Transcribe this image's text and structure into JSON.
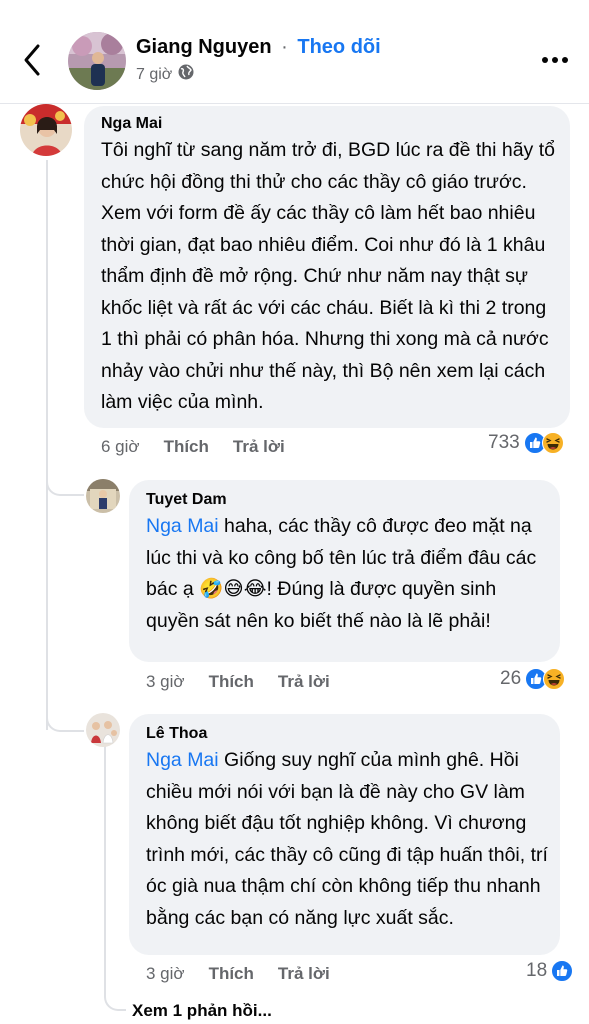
{
  "header": {
    "author": "Giang Nguyen",
    "separator": "·",
    "follow_label": "Theo dõi",
    "time": "7 giờ",
    "audience_icon": "globe-icon",
    "back_icon": "back-arrow-icon",
    "more_icon": "more-icon"
  },
  "comments": [
    {
      "author": "Nga Mai",
      "text": "Tôi nghĩ từ  sang năm trở đi, BGD lúc ra đề thi hãy tổ chức hội đồng thi thử cho các thầy cô giáo  trước. Xem với form đề ấy các thầy cô làm hết bao nhiêu thời gian,  đạt bao nhiêu điểm. Coi như đó là 1 khâu thẩm định đề mở rộng.  Chứ như năm nay thật sự khốc liệt và rất ác với các cháu. Biết là kì thi 2 trong 1 thì phải có phân hóa. Nhưng thi xong mà cả nước nhảy vào chửi  như thế này, thì Bộ nên xem  lại cách làm việc của mình.",
      "time": "6 giờ",
      "like_label": "Thích",
      "reply_label": "Trả lời",
      "reaction_count": "733",
      "reactions": [
        "like",
        "haha"
      ]
    },
    {
      "author": "Tuyet Dam",
      "mention": "Nga Mai",
      "text_before_emoji": " haha, các thầy cô được đeo mặt nạ lúc thi và ko công bố tên lúc trả điểm đâu các bác ạ ",
      "emojis": "🤣😅😂",
      "text_after_emoji": "! Đúng là được quyền sinh quyền sát nên ko biết thế nào là lẽ phải!",
      "time": "3 giờ",
      "like_label": "Thích",
      "reply_label": "Trả lời",
      "reaction_count": "26",
      "reactions": [
        "like",
        "haha"
      ]
    },
    {
      "author": "Lê Thoa",
      "mention": "Nga Mai",
      "text": " Giống suy nghĩ của mình ghê. Hồi chiều mới nói với bạn là đề này cho GV làm không biết đậu tốt nghiệp không. Vì chương trình mới, các thầy cô cũng đi tập huấn thôi, trí óc già nua thậm chí còn không tiếp thu nhanh bằng các bạn có năng lực xuất sắc.",
      "time": "3 giờ",
      "like_label": "Thích",
      "reply_label": "Trả lời",
      "reaction_count": "18",
      "reactions": [
        "like"
      ]
    }
  ],
  "view_more_label": "Xem 1 phản hồi...",
  "colors": {
    "link": "#1877f2",
    "bubble": "#f0f2f5",
    "secondary_text": "#65676b",
    "like": "#1877f2",
    "haha": "#f7b125"
  }
}
